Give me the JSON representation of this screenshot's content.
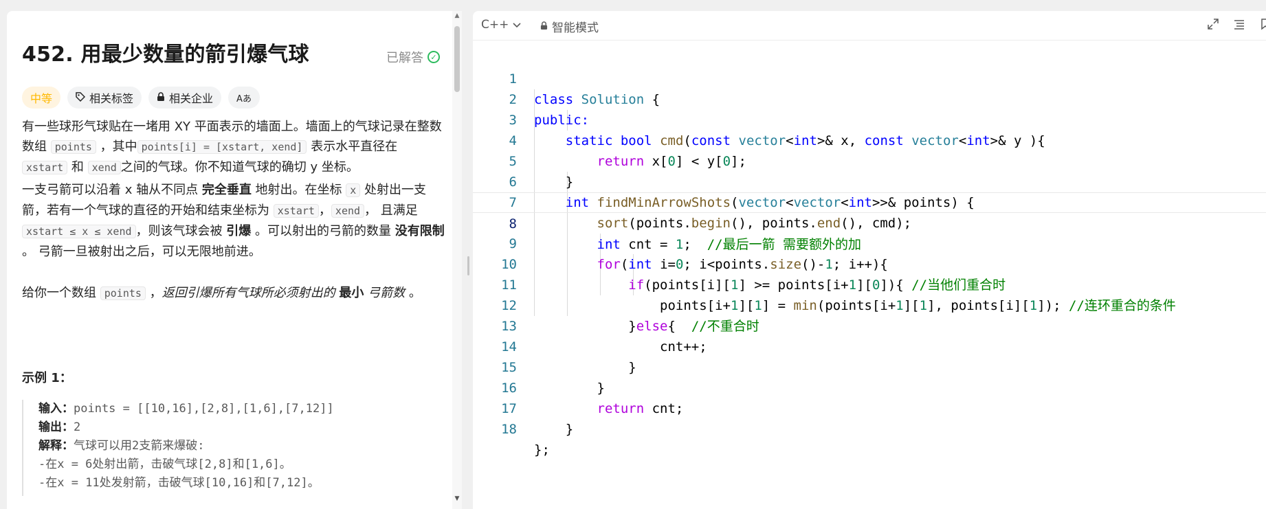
{
  "problem": {
    "title": "452. 用最少数量的箭引爆气球",
    "status": "已解答",
    "tags": {
      "difficulty": "中等",
      "related_tags": "相关标签",
      "related_companies": "相关企业",
      "font_toggle": "Aあ"
    },
    "desc1": {
      "a": "有一些球形气球贴在一堵用 XY 平面表示的墙面上。墙面上的气球记录在整数数组 ",
      "code1": "points",
      "b": " ，其中",
      "code2": "points[i] = [xstart, xend]",
      "c": " 表示水平直径在 ",
      "code3": "xstart",
      "d": " 和 ",
      "code4": "xend",
      "e": "之间的气球。你不知道气球的确切 y 坐标。"
    },
    "desc2": {
      "a": "一支弓箭可以沿着 x 轴从不同点 ",
      "b_bold": "完全垂直",
      "c": " 地射出。在坐标 ",
      "code1": "x",
      "d": " 处射出一支箭，若有一个气球的直径的开始和结束坐标为 ",
      "code2": "xstart",
      "e": "，",
      "code3": "xend",
      "f": "， 且满足  ",
      "code4": "xstart ≤ x ≤ xend",
      "g": "，则该气球会被 ",
      "h_bold": "引爆",
      "i": " 。可以射出的弓箭的数量 ",
      "j_bold": "没有限制",
      "k": " 。 弓箭一旦被射出之后，可以无限地前进。"
    },
    "desc3": {
      "a": "给你一个数组 ",
      "code1": "points",
      "b": " ，",
      "c_italic": "返回引爆所有气球所必须射出的 ",
      "d_bold": "最小",
      "e_italic": " 弓箭数",
      "f": " 。"
    },
    "example": {
      "title": "示例 1：",
      "input_label": "输入：",
      "input_value": "points = [[10,16],[2,8],[1,6],[7,12]]",
      "output_label": "输出：",
      "output_value": "2",
      "explain_label": "解释：",
      "explain_value": "气球可以用2支箭来爆破:",
      "line1": "-在x = 6处射出箭，击破气球[2,8]和[1,6]。",
      "line2": "-在x = 11处发射箭，击破气球[10,16]和[7,12]。"
    }
  },
  "editor": {
    "language": "C++",
    "mode": "智能模式",
    "current_line": 8,
    "lines": [
      {
        "n": "1"
      },
      {
        "n": "2"
      },
      {
        "n": "3"
      },
      {
        "n": "4"
      },
      {
        "n": "5"
      },
      {
        "n": "6"
      },
      {
        "n": "7"
      },
      {
        "n": "8"
      },
      {
        "n": "9"
      },
      {
        "n": "10"
      },
      {
        "n": "11"
      },
      {
        "n": "12"
      },
      {
        "n": "13"
      },
      {
        "n": "14"
      },
      {
        "n": "15"
      },
      {
        "n": "16"
      },
      {
        "n": "17"
      },
      {
        "n": "18"
      }
    ],
    "code": {
      "l1": {
        "kw": "class",
        "type": "Solution",
        "rest": " {"
      },
      "l2": {
        "kw": "public:"
      },
      "l3": {
        "kw1": "static",
        "kw2": "bool",
        "fn": "cmd",
        "open": "(",
        "kw3": "const",
        "t1": "vector",
        "lt": "<",
        "kw4": "int",
        "gt": ">& x, ",
        "kw5": "const",
        "t2": "vector",
        "lt2": "<",
        "kw6": "int",
        "gt2": ">& y ){"
      },
      "l4": {
        "kw": "return",
        "a": " x[",
        "n1": "0",
        "b": "] < y[",
        "n2": "0",
        "c": "];"
      },
      "l5": {
        "a": "}"
      },
      "l6": {
        "kw": "int",
        "fn": "findMinArrowShots",
        "a": "(",
        "t1": "vector",
        "b": "<",
        "t2": "vector",
        "c": "<",
        "kw2": "int",
        "d": ">>& points) {"
      },
      "l7": {
        "fn": "sort",
        "a": "(points.",
        "fn2": "begin",
        "b": "(), points.",
        "fn3": "end",
        "c": "(), cmd);"
      },
      "l8": {
        "kw": "int",
        "a": " cnt = ",
        "n": "1",
        "b": ";  ",
        "cm": "//最后一箭 需要额外的加"
      },
      "l9": {
        "kw": "for",
        "a": "(",
        "kw2": "int",
        "b": " i=",
        "n": "0",
        "c": "; i<points.",
        "fn": "size",
        "d": "()-",
        "n2": "1",
        "e": "; i++){"
      },
      "l10": {
        "kw": "if",
        "a": "(points[i][",
        "n1": "1",
        "b": "] >= points[i+",
        "n2": "1",
        "c": "][",
        "n3": "0",
        "d": "]){ ",
        "cm": "//当他们重合时"
      },
      "l11": {
        "a": "points[i+",
        "n1": "1",
        "b": "][",
        "n2": "1",
        "c": "] = ",
        "fn": "min",
        "d": "(points[i+",
        "n3": "1",
        "e": "][",
        "n4": "1",
        "f": "], points[i][",
        "n5": "1",
        "g": "]); ",
        "cm": "//连环重合的条件"
      },
      "l12": {
        "a": "}",
        "kw": "else",
        "b": "{  ",
        "cm": "//不重合时"
      },
      "l13": {
        "a": "cnt++;"
      },
      "l14": {
        "a": "}"
      },
      "l15": {
        "a": "}"
      },
      "l16": {
        "kw": "return",
        "a": " cnt;"
      },
      "l17": {
        "a": "}"
      },
      "l18": {
        "a": "};"
      }
    }
  }
}
